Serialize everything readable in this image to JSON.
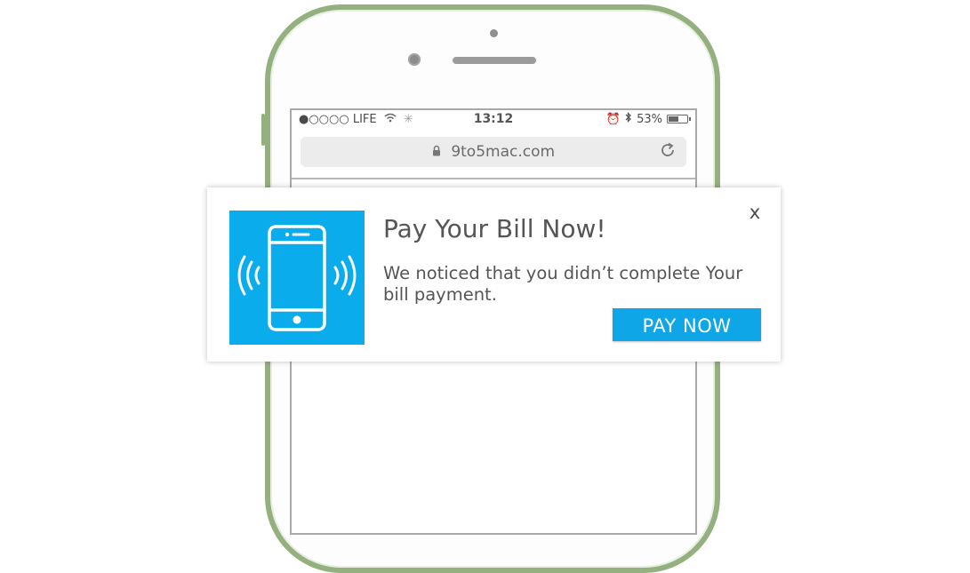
{
  "phone": {
    "frame_color": "#93b07e",
    "status_bar": {
      "carrier": "●○○○○ LIFE",
      "time": "13:12",
      "battery": "53%",
      "battery_level": 0.53
    },
    "url_bar": {
      "url": "9to5mac.com"
    }
  },
  "notification": {
    "title": "Pay Your Bill Now!",
    "message": "We noticed that you didn’t complete Your bill payment.",
    "close_label": "x",
    "cta_label": "PAY NOW",
    "accent_color": "#0ea6e6"
  }
}
